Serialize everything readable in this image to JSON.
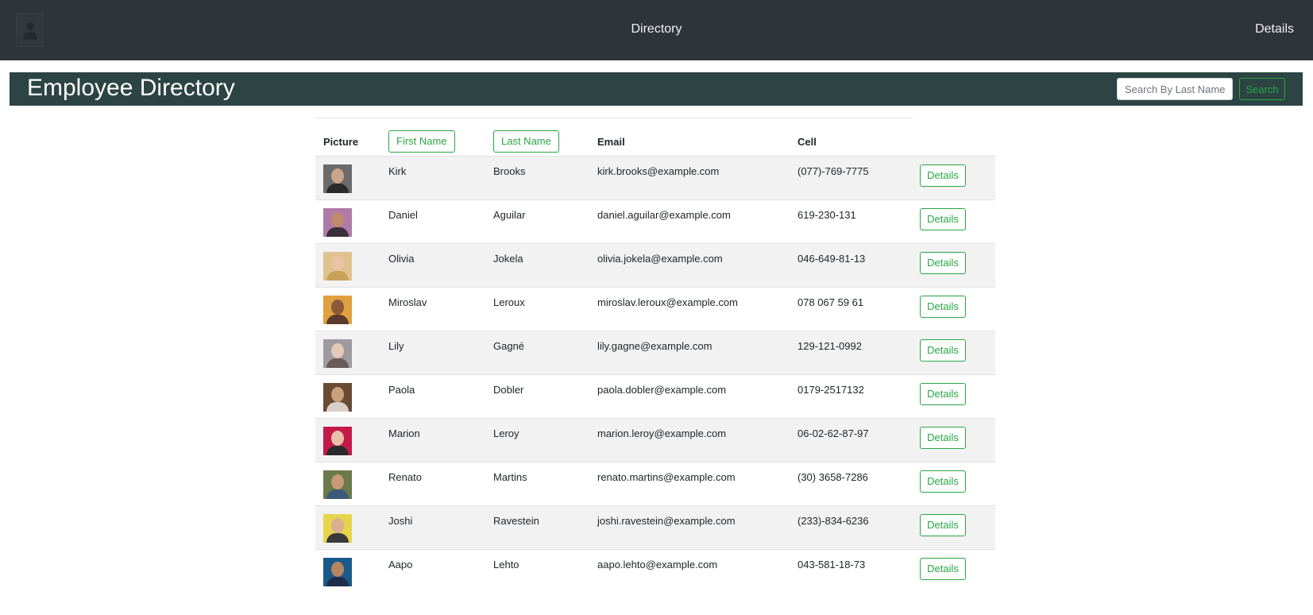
{
  "navbar": {
    "logo_icon": "user-silhouette-icon",
    "title": "Directory",
    "details_link": "Details"
  },
  "header": {
    "title": "Employee Directory",
    "search_placeholder": "Search By Last Name",
    "search_button": "Search"
  },
  "table": {
    "columns": {
      "picture": "Picture",
      "first_name": "First Name",
      "last_name": "Last Name",
      "email": "Email",
      "cell": "Cell"
    },
    "details_label": "Details",
    "rows": [
      {
        "first": "Kirk",
        "last": "Brooks",
        "email": "kirk.brooks@example.com",
        "cell": "(077)-769-7775",
        "bg": "#6b6b6b",
        "skin": "#c9a58a",
        "shirt": "#2a2a2a"
      },
      {
        "first": "Daniel",
        "last": "Aguilar",
        "email": "daniel.aguilar@example.com",
        "cell": "619-230-131",
        "bg": "#b07aa8",
        "skin": "#c08a6a",
        "shirt": "#3a2f3a"
      },
      {
        "first": "Olivia",
        "last": "Jokela",
        "email": "olivia.jokela@example.com",
        "cell": "046-649-81-13",
        "bg": "#e0c28f",
        "skin": "#e8c3a4",
        "shirt": "#c9a25c"
      },
      {
        "first": "Miroslav",
        "last": "Leroux",
        "email": "miroslav.leroux@example.com",
        "cell": "078 067 59 61",
        "bg": "#e0a040",
        "skin": "#8a5a3a",
        "shirt": "#5a3a2a"
      },
      {
        "first": "Lily",
        "last": "Gagné",
        "email": "lily.gagne@example.com",
        "cell": "129-121-0992",
        "bg": "#9e9aa0",
        "skin": "#e5c9b8",
        "shirt": "#6a5a55"
      },
      {
        "first": "Paola",
        "last": "Dobler",
        "email": "paola.dobler@example.com",
        "cell": "0179-2517132",
        "bg": "#6b4a35",
        "skin": "#c9a07a",
        "shirt": "#d8d0c8"
      },
      {
        "first": "Marion",
        "last": "Leroy",
        "email": "marion.leroy@example.com",
        "cell": "06-02-62-87-97",
        "bg": "#c41a4a",
        "skin": "#e9c0a8",
        "shirt": "#2a2a2a"
      },
      {
        "first": "Renato",
        "last": "Martins",
        "email": "renato.martins@example.com",
        "cell": "(30) 3658-7286",
        "bg": "#6a7a4a",
        "skin": "#c99a78",
        "shirt": "#3b5a7a"
      },
      {
        "first": "Joshi",
        "last": "Ravestein",
        "email": "joshi.ravestein@example.com",
        "cell": "(233)-834-6236",
        "bg": "#e8d44a",
        "skin": "#d8b090",
        "shirt": "#3a3a3a"
      },
      {
        "first": "Aapo",
        "last": "Lehto",
        "email": "aapo.lehto@example.com",
        "cell": "043-581-18-73",
        "bg": "#1a5a8a",
        "skin": "#b9855e",
        "shirt": "#1e2e4a"
      }
    ]
  },
  "colors": {
    "navbar_bg": "#2f3439",
    "header_bg": "#2c4443",
    "accent_green": "#28a745",
    "stripe": "#f2f2f2"
  }
}
